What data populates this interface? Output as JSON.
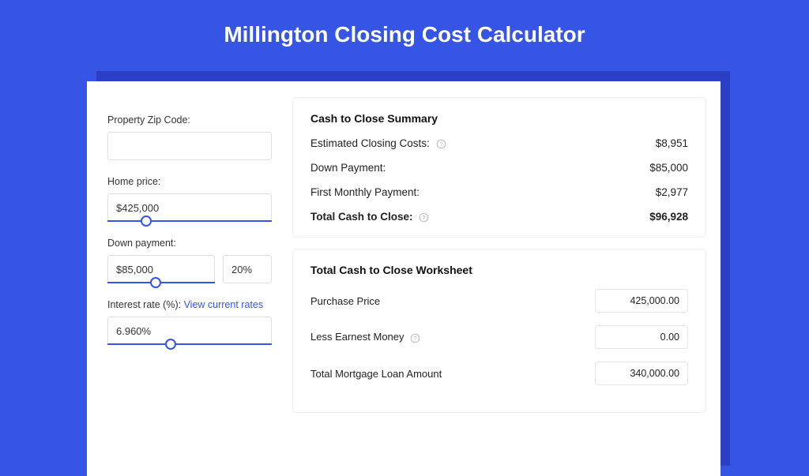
{
  "title": "Millington Closing Cost Calculator",
  "form": {
    "zip": {
      "label": "Property Zip Code:",
      "value": ""
    },
    "home_price": {
      "label": "Home price:",
      "value": "$425,000",
      "slider_pct": 20
    },
    "down_payment": {
      "label": "Down payment:",
      "value": "$85,000",
      "pct": "20%",
      "slider_pct": 40
    },
    "interest": {
      "label": "Interest rate (%): ",
      "link": "View current rates",
      "value": "6.960%",
      "slider_pct": 35
    }
  },
  "summary": {
    "heading": "Cash to Close Summary",
    "rows": [
      {
        "label": "Estimated Closing Costs:",
        "help": true,
        "value": "$8,951"
      },
      {
        "label": "Down Payment:",
        "help": false,
        "value": "$85,000"
      },
      {
        "label": "First Monthly Payment:",
        "help": false,
        "value": "$2,977"
      }
    ],
    "total": {
      "label": "Total Cash to Close:",
      "help": true,
      "value": "$96,928"
    }
  },
  "worksheet": {
    "heading": "Total Cash to Close Worksheet",
    "rows": [
      {
        "label": "Purchase Price",
        "help": false,
        "value": "425,000.00"
      },
      {
        "label": "Less Earnest Money",
        "help": true,
        "value": "0.00"
      },
      {
        "label": "Total Mortgage Loan Amount",
        "help": false,
        "value": "340,000.00"
      }
    ]
  }
}
